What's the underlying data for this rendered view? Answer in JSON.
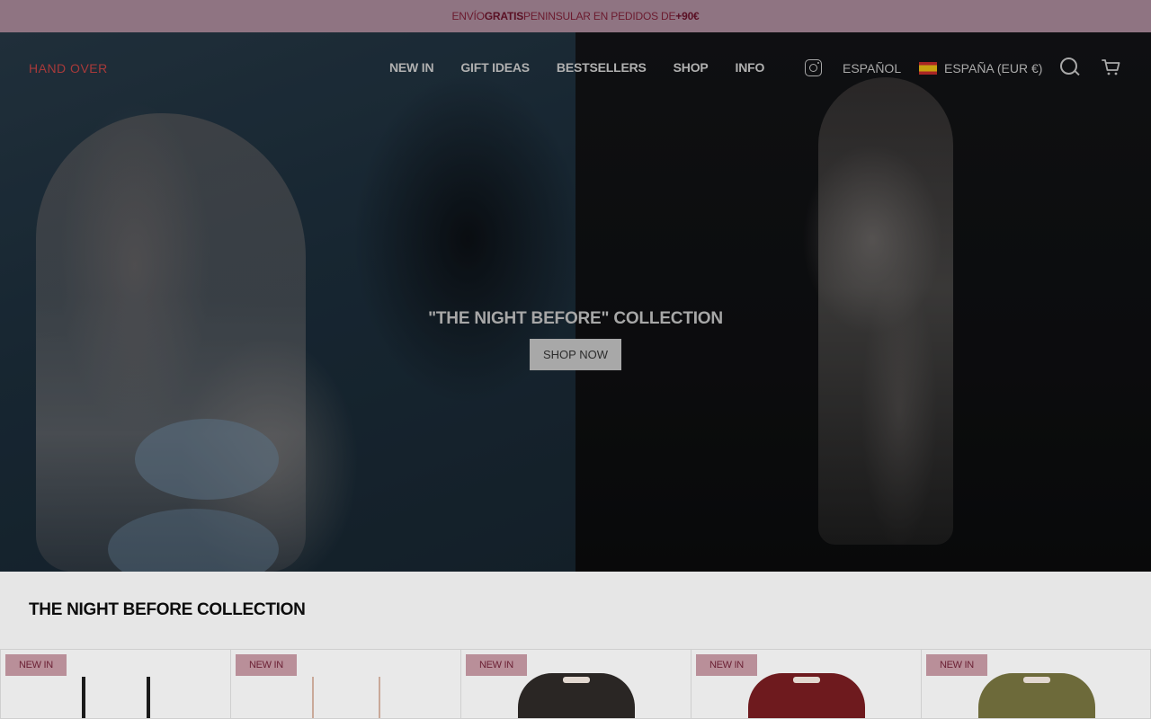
{
  "announcement": {
    "prefix": "ENVÍO ",
    "bold1": "GRATIS",
    "middle": " PENINSULAR EN PEDIDOS DE ",
    "bold2": "+90€"
  },
  "header": {
    "logo": "HAND OVER",
    "nav": [
      "NEW IN",
      "GIFT IDEAS",
      "BESTSELLERS",
      "SHOP",
      "INFO"
    ],
    "language": "ESPAÑOL",
    "country": "ESPAÑA (EUR €)",
    "icons": [
      "instagram-icon",
      "spain-flag-icon",
      "search-icon",
      "cart-icon"
    ]
  },
  "hero": {
    "title": "\"THE NIGHT BEFORE\" COLLECTION",
    "cta": "SHOP NOW"
  },
  "collection": {
    "title": "THE NIGHT BEFORE COLLECTION",
    "products": [
      {
        "badge": "NEW IN",
        "kind": "straps-black"
      },
      {
        "badge": "NEW IN",
        "kind": "straps-nude"
      },
      {
        "badge": "NEW IN",
        "kind": "shirt",
        "color": "#2a2624"
      },
      {
        "badge": "NEW IN",
        "kind": "shirt",
        "color": "#6e1a1e"
      },
      {
        "badge": "NEW IN",
        "kind": "shirt",
        "color": "#6d6a3a"
      }
    ]
  }
}
